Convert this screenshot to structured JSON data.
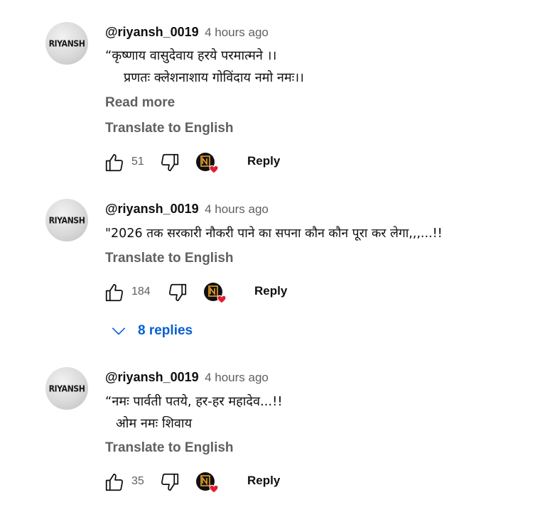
{
  "comments": [
    {
      "author": "@riyansh_0019",
      "time": "4 hours ago",
      "avatar_text": "RIYANSH",
      "lines": [
        "“कृष्णाय वासुदेवाय हरये परमात्मने ।।",
        "प्रणतः क्लेशनाशाय गोविंदाय नमो नमः।।"
      ],
      "read_more": "Read more",
      "translate": "Translate to English",
      "likes": "51",
      "reply": "Reply"
    },
    {
      "author": "@riyansh_0019",
      "time": "4 hours ago",
      "avatar_text": "RIYANSH",
      "lines": [
        "\"2026 तक सरकारी नौकरी पाने का सपना कौन कौन पूरा कर लेगा,,,...!!"
      ],
      "translate": "Translate to English",
      "likes": "184",
      "reply": "Reply",
      "replies": "8 replies"
    },
    {
      "author": "@riyansh_0019",
      "time": "4 hours ago",
      "avatar_text": "RIYANSH",
      "lines": [
        "“नमः पार्वती पतये, हर-हर महादेव...!!",
        "ओम नमः शिवाय"
      ],
      "translate": "Translate to English",
      "likes": "35",
      "reply": "Reply"
    }
  ],
  "colors": {
    "text_primary": "#0f0f0f",
    "text_secondary": "#606060",
    "link_blue": "#065fd4",
    "heart_red": "#e11d2f"
  },
  "icons": {
    "like": "thumbs-up-icon",
    "dislike": "thumbs-down-icon",
    "creator_heart": "creator-heart-icon",
    "expand": "chevron-down-icon"
  }
}
